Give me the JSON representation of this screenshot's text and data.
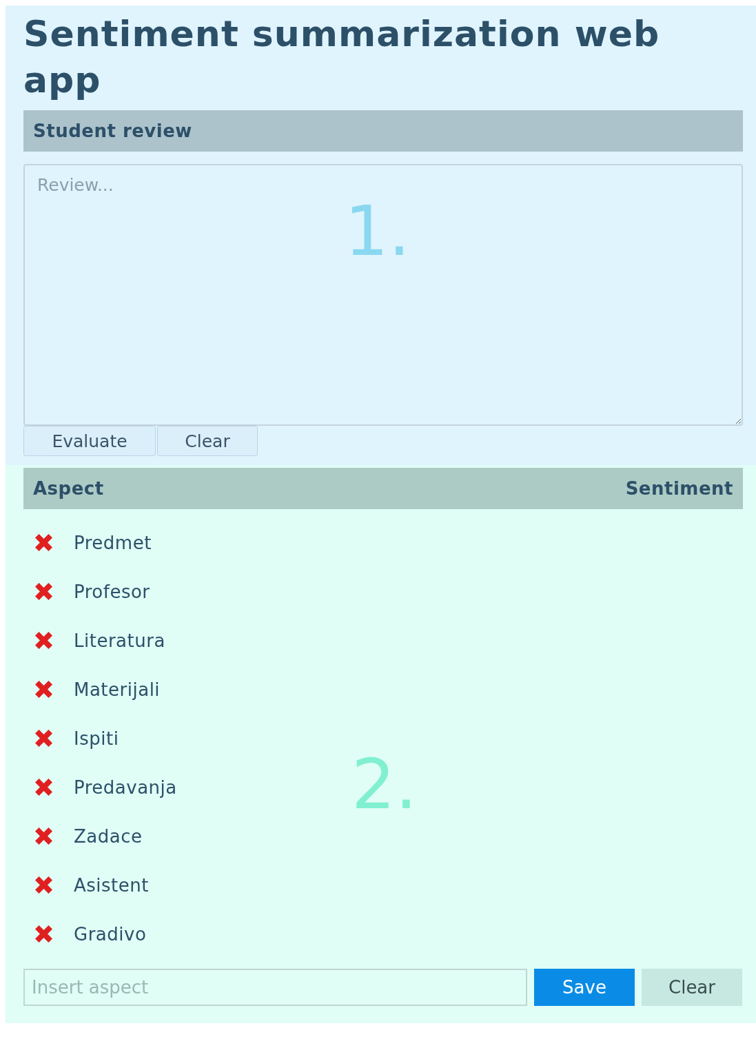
{
  "title": "Sentiment summarization web app",
  "review": {
    "heading": "Student review",
    "placeholder": "Review...",
    "marker": "1.",
    "buttons": [
      "Evaluate",
      "Clear"
    ]
  },
  "aspects": {
    "columns": [
      "Aspect",
      "Sentiment"
    ],
    "marker": "2.",
    "rows": [
      {
        "name": "Predmet",
        "evaluated": false
      },
      {
        "name": "Profesor",
        "evaluated": false
      },
      {
        "name": "Literatura",
        "evaluated": false
      },
      {
        "name": "Materijali",
        "evaluated": false
      },
      {
        "name": "Ispiti",
        "evaluated": false
      },
      {
        "name": "Predavanja",
        "evaluated": false
      },
      {
        "name": "Zadace",
        "evaluated": false
      },
      {
        "name": "Asistent",
        "evaluated": false
      },
      {
        "name": "Gradivo",
        "evaluated": false
      }
    ],
    "input": {
      "placeholder": "Insert aspect"
    },
    "buttons": [
      {
        "label": "Save",
        "kind": "primary"
      },
      {
        "label": "Clear",
        "kind": "secondary"
      }
    ]
  }
}
